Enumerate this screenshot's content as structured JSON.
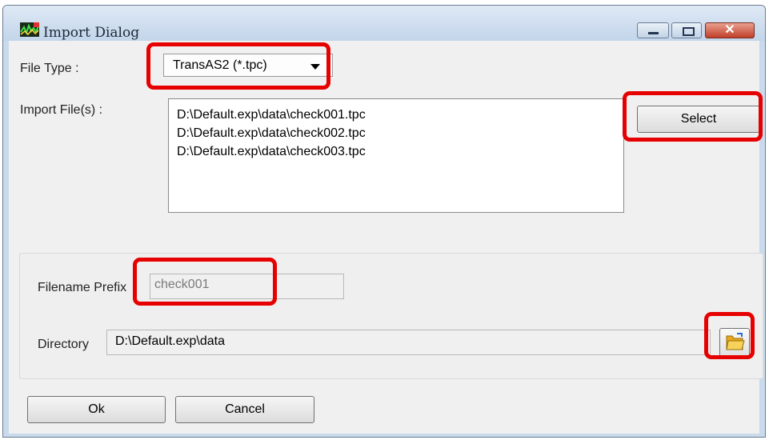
{
  "window": {
    "title": "Import Dialog",
    "controls": {
      "minimize": "minimize",
      "maximize": "maximize",
      "close": "✕"
    }
  },
  "file_type": {
    "label": "File Type :",
    "selected": "TransAS2 (*.tpc)"
  },
  "import_files": {
    "label": "Import File(s) :",
    "items": [
      "D:\\Default.exp\\data\\check001.tpc",
      "D:\\Default.exp\\data\\check002.tpc",
      "D:\\Default.exp\\data\\check003.tpc"
    ],
    "select_label": "Select"
  },
  "filename_prefix": {
    "label": "Filename Prefix",
    "value": "check001"
  },
  "directory": {
    "label": "Directory",
    "value": "D:\\Default.exp\\data",
    "browse_icon": "folder-open-icon"
  },
  "buttons": {
    "ok": "Ok",
    "cancel": "Cancel"
  },
  "colors": {
    "highlight": "#e60000",
    "titlebar": "#c9daec",
    "close_button": "#c0402a"
  }
}
